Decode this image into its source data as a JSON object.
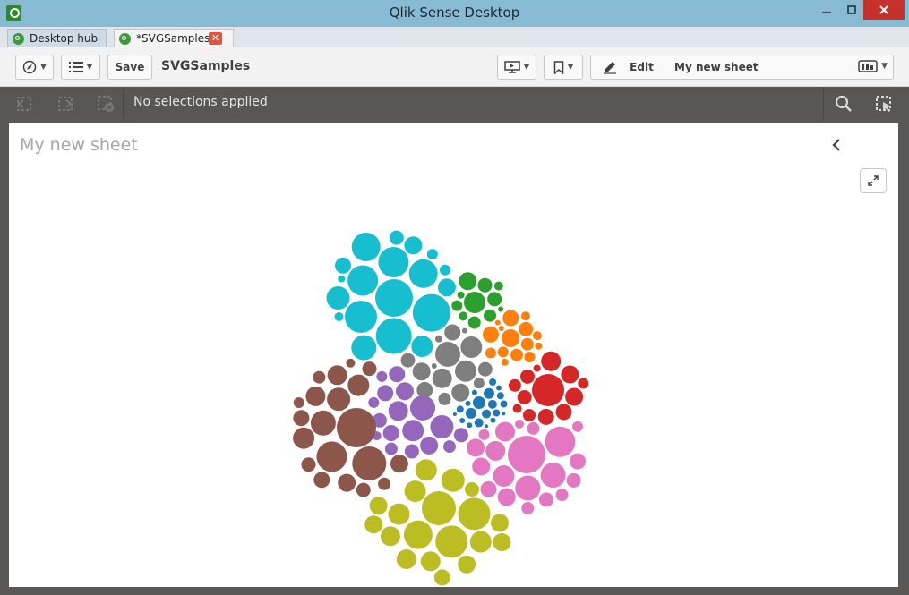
{
  "window": {
    "title": "Qlik Sense Desktop"
  },
  "tabs": [
    {
      "label": "Desktop hub"
    },
    {
      "label": "*SVGSamples",
      "close_icon": "close-icon"
    }
  ],
  "toolbar": {
    "save_label": "Save",
    "app_name": "SVGSamples",
    "edit_label": "Edit",
    "sheet_selector_label": "My new sheet"
  },
  "selections": {
    "status_text": "No selections applied"
  },
  "sheet": {
    "title": "My new sheet"
  },
  "colors": {
    "cyan": "#17becf",
    "green": "#2ca02c",
    "orange": "#ff7f0e",
    "gray": "#7f7f7f",
    "red": "#d62728",
    "blue": "#1f77b4",
    "purple": "#9467bd",
    "brown": "#8c564b",
    "pink": "#e377c2",
    "olive": "#bcbd22"
  },
  "chart_data": {
    "type": "packed-bubble",
    "groups": [
      {
        "color": "cyan",
        "sizes": [
          21,
          21,
          20,
          18,
          17,
          17,
          16,
          16,
          14,
          13,
          12,
          10,
          10,
          9,
          8,
          6,
          6,
          5,
          4
        ]
      },
      {
        "color": "green",
        "sizes": [
          12,
          10,
          8,
          8,
          7,
          7,
          6,
          5,
          5,
          4,
          3
        ]
      },
      {
        "color": "orange",
        "sizes": [
          10,
          9,
          9,
          8,
          7,
          7,
          6,
          6,
          6,
          5,
          5,
          4,
          4,
          3,
          3
        ]
      },
      {
        "color": "gray",
        "sizes": [
          14,
          12,
          12,
          11,
          10,
          10,
          9,
          9,
          8,
          8,
          7,
          6,
          4,
          3,
          3
        ]
      },
      {
        "color": "red",
        "sizes": [
          18,
          11,
          10,
          10,
          9,
          9,
          8,
          8,
          7,
          7,
          6,
          5,
          4
        ]
      },
      {
        "color": "blue",
        "sizes": [
          7,
          6,
          6,
          5,
          5,
          5,
          4,
          4,
          4,
          4,
          4,
          3,
          3,
          3,
          3,
          3,
          3,
          2,
          2,
          2
        ]
      },
      {
        "color": "purple",
        "sizes": [
          14,
          13,
          12,
          11,
          10,
          10,
          9,
          9,
          9,
          8,
          8,
          8,
          7,
          7,
          6,
          6,
          5
        ]
      },
      {
        "color": "brown",
        "sizes": [
          22,
          19,
          17,
          14,
          13,
          12,
          12,
          11,
          11,
          10,
          10,
          9,
          9,
          8,
          8,
          8,
          7,
          7,
          6,
          5
        ]
      },
      {
        "color": "pink",
        "sizes": [
          21,
          17,
          14,
          14,
          12,
          11,
          11,
          10,
          10,
          10,
          9,
          9,
          8,
          8,
          7,
          7,
          7,
          6,
          6,
          5
        ]
      },
      {
        "color": "olive",
        "sizes": [
          19,
          18,
          18,
          16,
          13,
          12,
          12,
          12,
          12,
          11,
          11,
          11,
          10,
          10,
          10,
          10,
          10,
          9,
          8
        ]
      }
    ]
  }
}
